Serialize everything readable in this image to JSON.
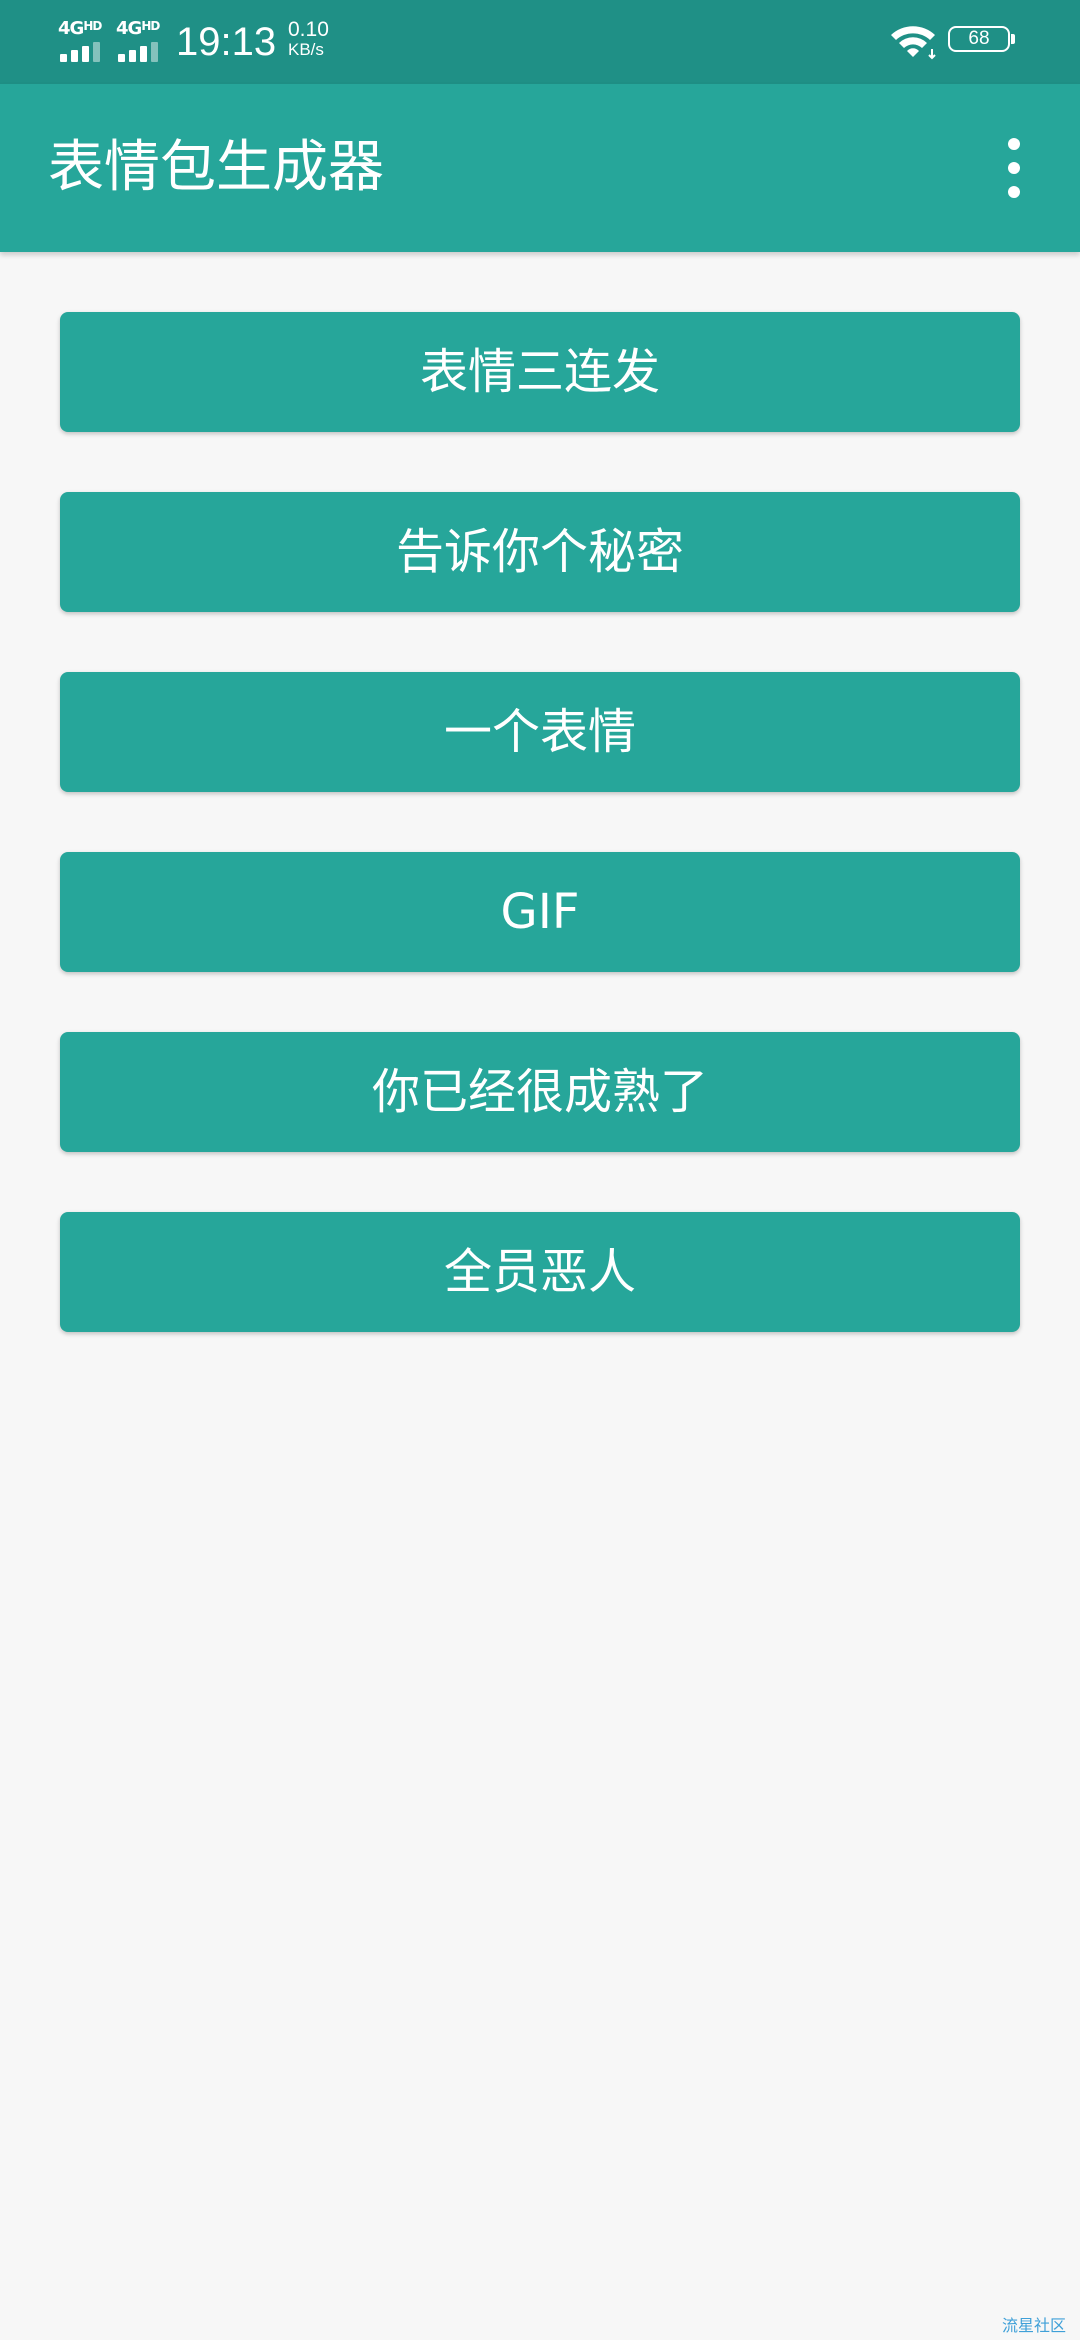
{
  "status_bar": {
    "network_1": "4G",
    "network_1_sup": "HD",
    "network_2": "4G",
    "network_2_sup": "HD",
    "time": "19:13",
    "net_speed_value": "0.10",
    "net_speed_unit": "KB/s",
    "battery_level": "68",
    "wifi_icon": "wifi-icon",
    "battery_icon": "battery-icon"
  },
  "app_bar": {
    "title": "表情包生成器",
    "menu_icon": "more-vert-icon"
  },
  "buttons": [
    {
      "label": "表情三连发"
    },
    {
      "label": "告诉你个秘密"
    },
    {
      "label": "一个表情"
    },
    {
      "label": "GIF"
    },
    {
      "label": "你已经很成熟了"
    },
    {
      "label": "全员恶人"
    }
  ],
  "watermark": "流星社区",
  "colors": {
    "status_bar": "#1f9086",
    "primary": "#26a69a",
    "background": "#f7f7f7",
    "on_primary": "#ffffff"
  }
}
